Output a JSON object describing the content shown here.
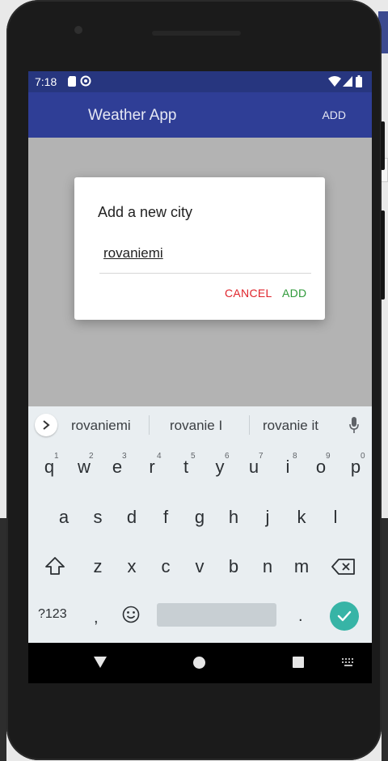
{
  "status_bar": {
    "time": "7:18"
  },
  "app_bar": {
    "title": "Weather App",
    "action_add": "ADD"
  },
  "dialog": {
    "title": "Add a new city",
    "input_value": "rovaniemi",
    "cancel_label": "CANCEL",
    "add_label": "ADD"
  },
  "keyboard": {
    "suggestions": [
      "rovaniemi",
      "rovanie I",
      "rovanie it"
    ],
    "row1": [
      "q",
      "w",
      "e",
      "r",
      "t",
      "y",
      "u",
      "i",
      "o",
      "p"
    ],
    "row1_hints": [
      "1",
      "2",
      "3",
      "4",
      "5",
      "6",
      "7",
      "8",
      "9",
      "0"
    ],
    "row2": [
      "a",
      "s",
      "d",
      "f",
      "g",
      "h",
      "j",
      "k",
      "l"
    ],
    "row3": [
      "z",
      "x",
      "c",
      "v",
      "b",
      "n",
      "m"
    ],
    "symbols_label": "?123",
    "comma_label": ",",
    "period_label": "."
  },
  "colors": {
    "status_bar": "#27367f",
    "app_bar": "#2f3e96",
    "cancel": "#e0252c",
    "add": "#2f9a3a",
    "enter_key": "#37b4a6"
  },
  "icons": [
    "sim-card-icon",
    "data-saver-icon",
    "wifi-icon",
    "signal-icon",
    "battery-icon",
    "chevron-right-icon",
    "mic-icon",
    "shift-icon",
    "backspace-icon",
    "emoji-icon",
    "check-icon",
    "back-triangle-icon",
    "home-circle-icon",
    "recents-square-icon",
    "keyboard-switch-icon"
  ]
}
